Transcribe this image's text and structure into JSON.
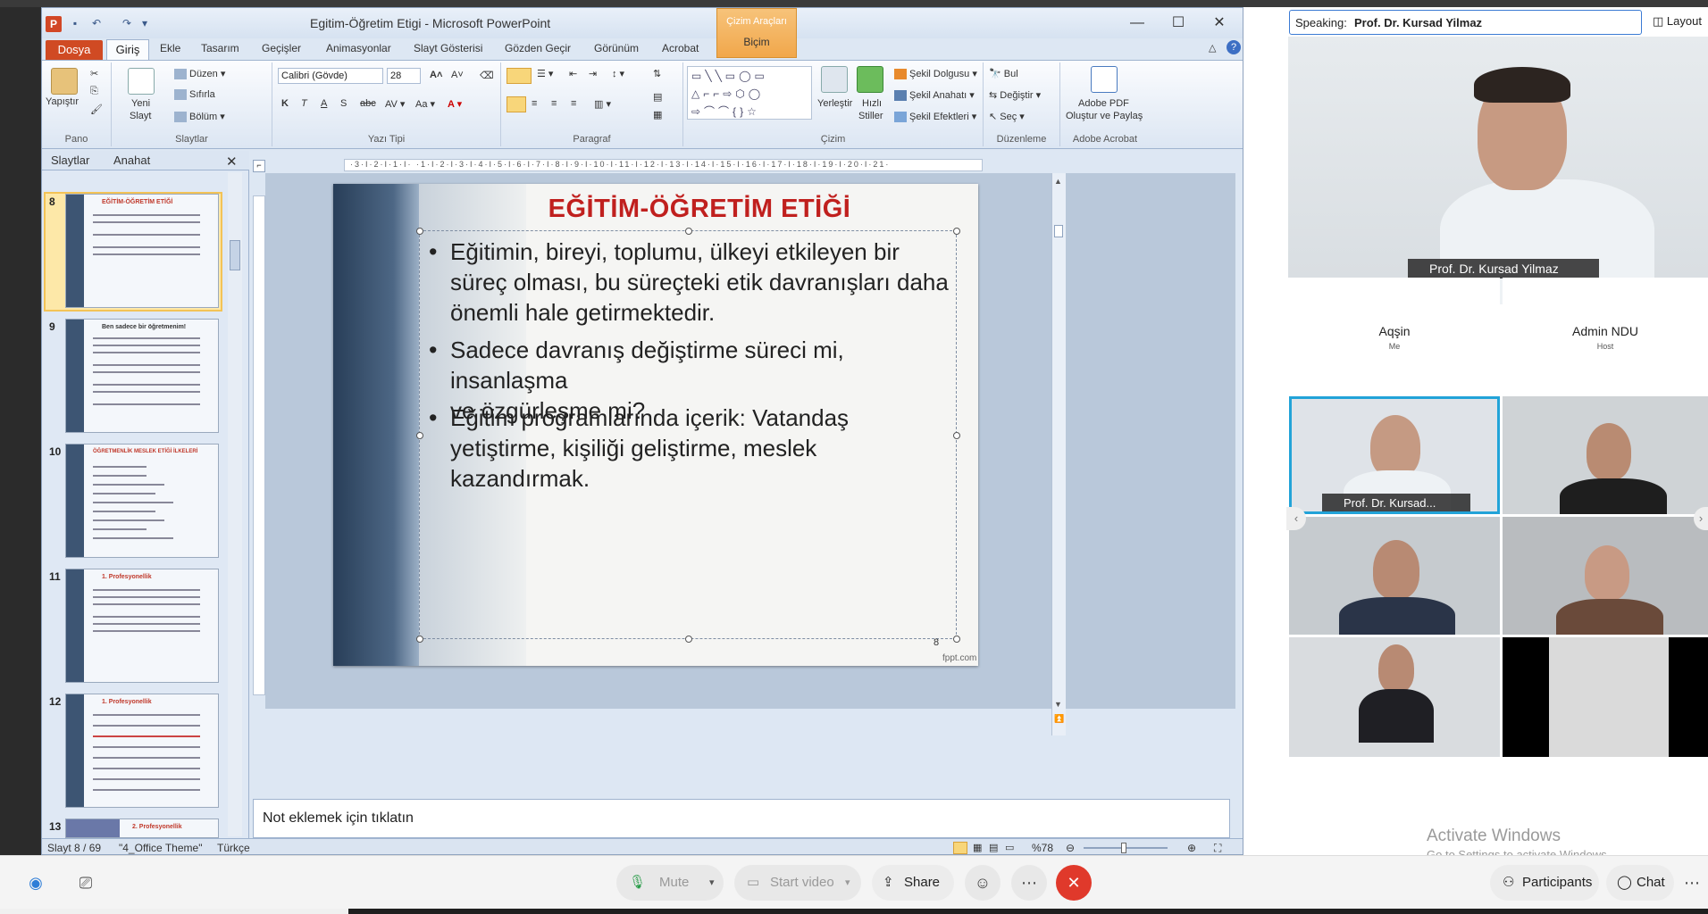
{
  "ppt": {
    "window_title": "Egitim-Öğretim Etigi  -  Microsoft PowerPoint",
    "context_tab_group": "Çizim Araçları",
    "context_tab": "Biçim",
    "tabs": [
      "Dosya",
      "Giriş",
      "Ekle",
      "Tasarım",
      "Geçişler",
      "Animasyonlar",
      "Slayt Gösterisi",
      "Gözden Geçir",
      "Görünüm",
      "Acrobat"
    ],
    "ribbon": {
      "clipboard": {
        "paste": "Yapıştır",
        "label": "Pano"
      },
      "slides": {
        "new_slide_l1": "Yeni",
        "new_slide_l2": "Slayt",
        "layout": "Düzen",
        "reset": "Sıfırla",
        "section": "Bölüm",
        "label": "Slaytlar"
      },
      "font": {
        "font_name": "Calibri (Gövde)",
        "font_size": "28",
        "label": "Yazı Tipi"
      },
      "paragraph": {
        "label": "Paragraf"
      },
      "drawing": {
        "arrange": "Yerleştir",
        "quick_l1": "Hızlı",
        "quick_l2": "Stiller",
        "fill": "Şekil Dolgusu",
        "outline": "Şekil Anahatı",
        "effects": "Şekil Efektleri",
        "label": "Çizim"
      },
      "editing": {
        "find": "Bul",
        "replace": "Değiştir",
        "select": "Seç",
        "label": "Düzenleme"
      },
      "acrobat": {
        "l1": "Adobe PDF",
        "l2": "Oluştur ve Paylaş",
        "label": "Adobe Acrobat"
      }
    },
    "pane_tabs": [
      "Slaytlar",
      "Anahat"
    ],
    "thumbnails": [
      {
        "num": "8",
        "title": "EĞİTİM-ÖĞRETİM ETİĞİ"
      },
      {
        "num": "9",
        "title": "Ben sadece bir öğretmenim!"
      },
      {
        "num": "10",
        "title": "ÖĞRETMENLİK MESLEK ETİĞİ İLKELERİ"
      },
      {
        "num": "11",
        "title": "1. Profesyonellik"
      },
      {
        "num": "12",
        "title": "1. Profesyonellik"
      },
      {
        "num": "13",
        "title": "2. Profesyonellik"
      }
    ],
    "slide": {
      "title": "EĞİTİM-ÖĞRETİM ETİĞİ",
      "bullets": [
        [
          "Eğitimin, bireyi, toplumu, ülkeyi etkileyen bir",
          "süreç olması, bu süreçteki etik davranışları daha",
          "önemli hale getirmektedir."
        ],
        [
          "Sadece davranış değiştirme süreci mi, insanlaşma",
          "ve özgürleşme mi?"
        ],
        [
          "Eğitim programlarında içerik: Vatandaş",
          "yetiştirme, kişiliği geliştirme, meslek",
          "kazandırmak."
        ]
      ],
      "number": "8",
      "watermark": "fppt.com"
    },
    "notes_placeholder": "Not eklemek için tıklatın",
    "status": {
      "slide": "Slayt 8 / 69",
      "theme": "\"4_Office Theme\"",
      "language": "Türkçe",
      "zoom": "%78"
    }
  },
  "meeting": {
    "speaking_label": "Speaking:",
    "speaking_name": "Prof. Dr. Kursad Yilmaz",
    "layout_label": "Layout",
    "main_name": "Prof. Dr. Kursad Yilmaz",
    "tiles": [
      {
        "name": "Aqşin",
        "sub": "Me"
      },
      {
        "name": "Admin NDU",
        "sub": "Host"
      },
      {
        "name": "Prof. Dr. Kursad..."
      }
    ],
    "activate_title": "Activate Windows",
    "activate_sub": "Go to Settings to activate Windows."
  },
  "toolbar": {
    "mute": "Mute",
    "start_video": "Start video",
    "share": "Share",
    "participants": "Participants",
    "chat": "Chat"
  },
  "colors": {
    "accent": "#d04a23",
    "title_red": "#c0201e",
    "end_call": "#e0392b",
    "highlight": "#f3c356"
  }
}
